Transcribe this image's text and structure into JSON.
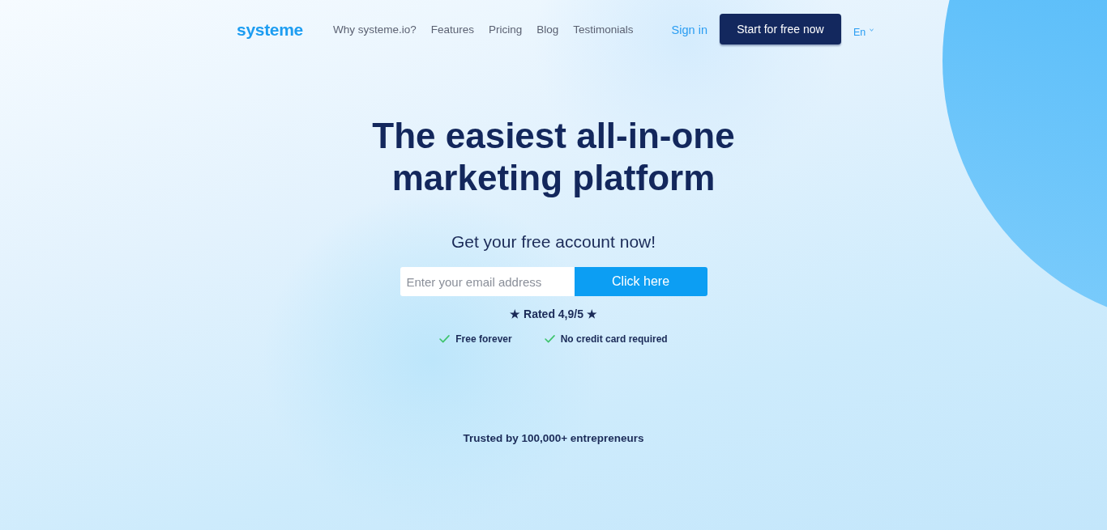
{
  "header": {
    "logo": "systeme",
    "nav": [
      {
        "label": "Why systeme.io?"
      },
      {
        "label": "Features"
      },
      {
        "label": "Pricing"
      },
      {
        "label": "Blog"
      },
      {
        "label": "Testimonials"
      }
    ],
    "sign_in": "Sign in",
    "cta": "Start for free now",
    "language": "En"
  },
  "hero": {
    "title": "The easiest all-in-one marketing platform",
    "subtitle": "Get your free account now!",
    "form": {
      "placeholder": "Enter your email address",
      "button": "Click here"
    },
    "rating": "★ Rated 4,9/5 ★",
    "benefits": [
      "Free forever",
      "No credit card required"
    ],
    "trust": "Trusted by 100,000+ entrepreneurs"
  }
}
